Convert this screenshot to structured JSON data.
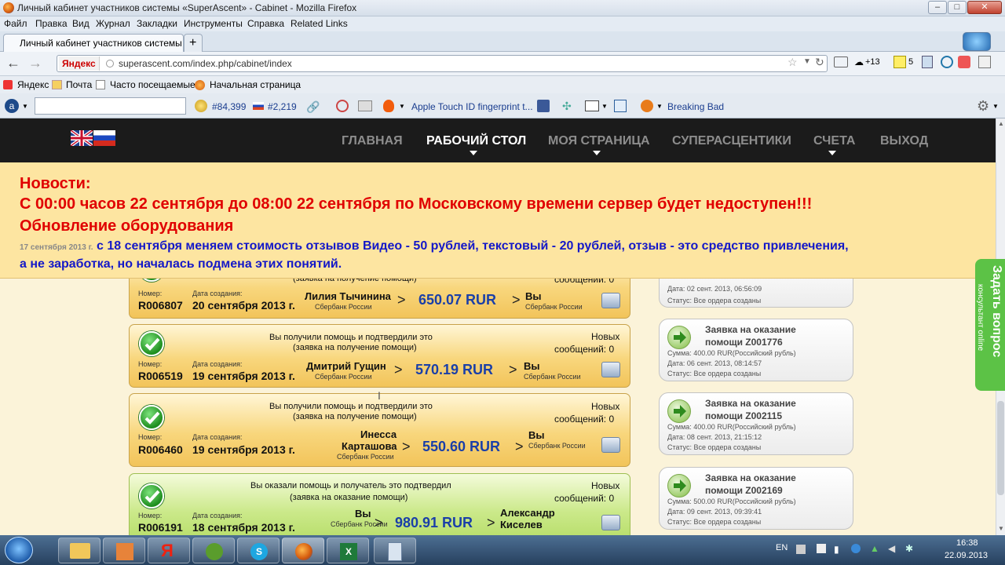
{
  "window": {
    "title": "Личный кабинет участников системы «SuperAscent» - Cabinet - Mozilla Firefox"
  },
  "menu": [
    "Файл",
    "Правка",
    "Вид",
    "Журнал",
    "Закладки",
    "Инструменты",
    "Справка",
    "Related Links"
  ],
  "tabs": [
    {
      "label": "Личный кабинет участников системы ..."
    },
    {
      "label": "+"
    }
  ],
  "nav": {
    "url": "superascent.com/index.php/cabinet/index",
    "search_engine": "Яндекс",
    "counter": "+13",
    "badge": "5"
  },
  "bookmarks": [
    "Яндекс",
    "Почта",
    "Часто посещаемые",
    "Начальная страница"
  ],
  "addon": {
    "rank": "#84,399",
    "rank_ru": "#2,219",
    "items": [
      "Apple Touch ID fingerprint t...",
      "Breaking Bad"
    ]
  },
  "site_nav": {
    "items": [
      {
        "label": "ГЛАВНАЯ"
      },
      {
        "label": "РАБОЧИЙ СТОЛ"
      },
      {
        "label": "МОЯ СТРАНИЦА"
      },
      {
        "label": "СУПЕРАСЦЕНТИКИ"
      },
      {
        "label": "СЧЕТА"
      },
      {
        "label": "ВЫХОД"
      }
    ]
  },
  "news": {
    "heading": "Новости:",
    "line1": "С 00:00 часов 22 сентября до 08:00 22 сентября по Московскому времени сервер будет недоступен!!!",
    "line2": "Обновление оборудования",
    "date": "17 сентября 2013 г.",
    "line3": "с 18 сентября меняем стоимость отзывов Видео - 50 рублей, текстовый - 20 рублей, отзыв - это средство привлечения,",
    "line4": "а не заработка, но началась подмена этих понятий."
  },
  "labels": {
    "number": "Номер:",
    "created": "Дата создания:",
    "new_messages": "Новых",
    "messages_count": "сообщений: 0",
    "bank": "Сбербанк России",
    "you": "Вы"
  },
  "orders": [
    {
      "status": "(заявка на получение помощи)",
      "number": "R006807",
      "date": "20 сентября 2013 г.",
      "from": "Лилия Тычинина",
      "amount": "650.07 RUR",
      "to": "Вы"
    },
    {
      "status": "Вы получили помощь и подтвердили это",
      "status2": "(заявка на получение помощи)",
      "number": "R006519",
      "date": "19 сентября 2013 г.",
      "from": "Дмитрий Гущин",
      "amount": "570.19 RUR",
      "to": "Вы"
    },
    {
      "status": "Вы получили помощь и подтвердили это",
      "status2": "(заявка на получение помощи)",
      "number": "R006460",
      "date": "19 сентября 2013 г.",
      "from": "Инесса",
      "from2": "Карташова",
      "amount": "550.60 RUR",
      "to": "Вы"
    },
    {
      "status": "Вы оказали помощь и получатель это подтвердил",
      "status2": "(заявка на оказание помощи)",
      "number": "R006191",
      "date": "18 сентября 2013 г.",
      "from": "Вы",
      "amount": "980.91 RUR",
      "to": "Александр",
      "to2": "Киселев"
    }
  ],
  "requests": [
    {
      "date": "Дата: 02 сент. 2013, 06:56:09",
      "status": "Статус: Все ордера созданы"
    },
    {
      "title1": "Заявка на оказание",
      "title2": "помощи Z001776",
      "sum": "Сумма: 400.00 RUR(Российский рубль)",
      "date": "Дата: 06 сент. 2013, 08:14:57",
      "status": "Статус: Все ордера созданы"
    },
    {
      "title1": "Заявка на оказание",
      "title2": "помощи Z002115",
      "sum": "Сумма: 400.00 RUR(Российский рубль)",
      "date": "Дата: 08 сент. 2013, 21:15:12",
      "status": "Статус: Все ордера созданы"
    },
    {
      "title1": "Заявка на оказание",
      "title2": "помощи Z002169",
      "sum": "Сумма: 500.00 RUR(Российский рубль)",
      "date": "Дата: 09 сент. 2013, 09:39:41",
      "status": "Статус: Все ордера созданы"
    }
  ],
  "ask": {
    "title": "Задать вопрос",
    "sub": "консультант online"
  },
  "tray": {
    "lang": "EN",
    "time": "16:38",
    "date": "22.09.2013"
  }
}
